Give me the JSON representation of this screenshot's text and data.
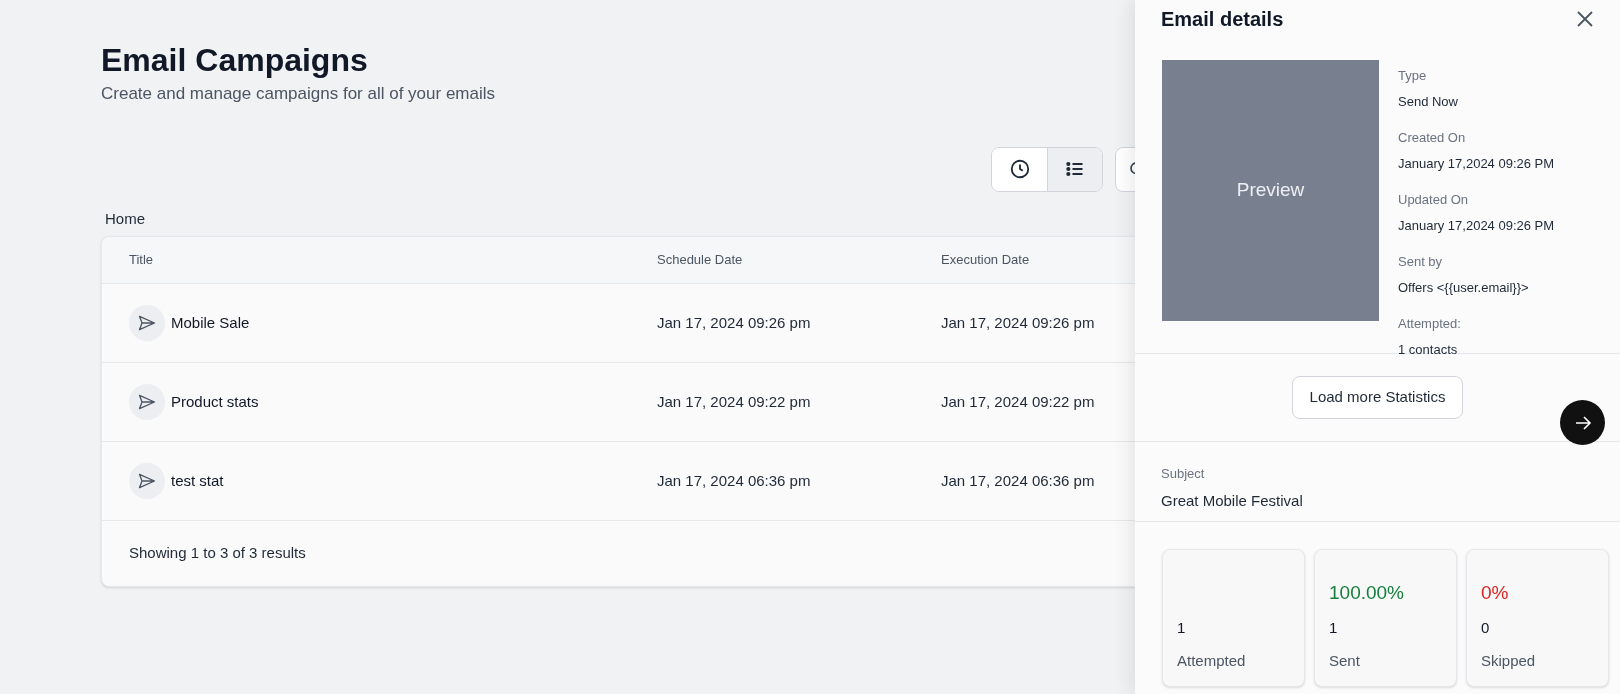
{
  "page": {
    "title": "Email Campaigns",
    "subtitle": "Create and manage campaigns for all of your emails"
  },
  "view_toggle": [
    {
      "kind": "clock",
      "selected": false
    },
    {
      "kind": "list",
      "selected": true
    }
  ],
  "breadcrumb": "Home",
  "table": {
    "columns": [
      "Title",
      "Schedule Date",
      "Execution Date"
    ],
    "rows": [
      {
        "title": "Mobile Sale",
        "schedule_date": "Jan 17, 2024 09:26 pm",
        "execution_date": "Jan 17, 2024 09:26 pm"
      },
      {
        "title": "Product stats",
        "schedule_date": "Jan 17, 2024 09:22 pm",
        "execution_date": "Jan 17, 2024 09:22 pm"
      },
      {
        "title": "test stat",
        "schedule_date": "Jan 17, 2024 06:36 pm",
        "execution_date": "Jan 17, 2024 06:36 pm"
      }
    ],
    "footer": "Showing 1 to 3 of 3 results"
  },
  "details": {
    "title": "Email details",
    "preview": "Preview",
    "fields": [
      {
        "label": "Type",
        "value": "Send Now"
      },
      {
        "label": "Created On",
        "value": "January 17,2024 09:26 PM"
      },
      {
        "label": "Updated On",
        "value": "January 17,2024 09:26 PM"
      },
      {
        "label": "Sent by",
        "value": "Offers <{{user.email}}>"
      },
      {
        "label": "Attempted:",
        "value": "1 contacts"
      }
    ],
    "load_more": "Load more Statistics",
    "subject_label": "Subject",
    "subject": "Great Mobile Festival",
    "stats": [
      {
        "count": "1",
        "label": "Attempted"
      },
      {
        "percent": "100.00%",
        "color": "#15803d",
        "count": "1",
        "label": "Sent"
      },
      {
        "percent": "0%",
        "color": "#dc2626",
        "count": "0",
        "label": "Skipped"
      }
    ]
  }
}
